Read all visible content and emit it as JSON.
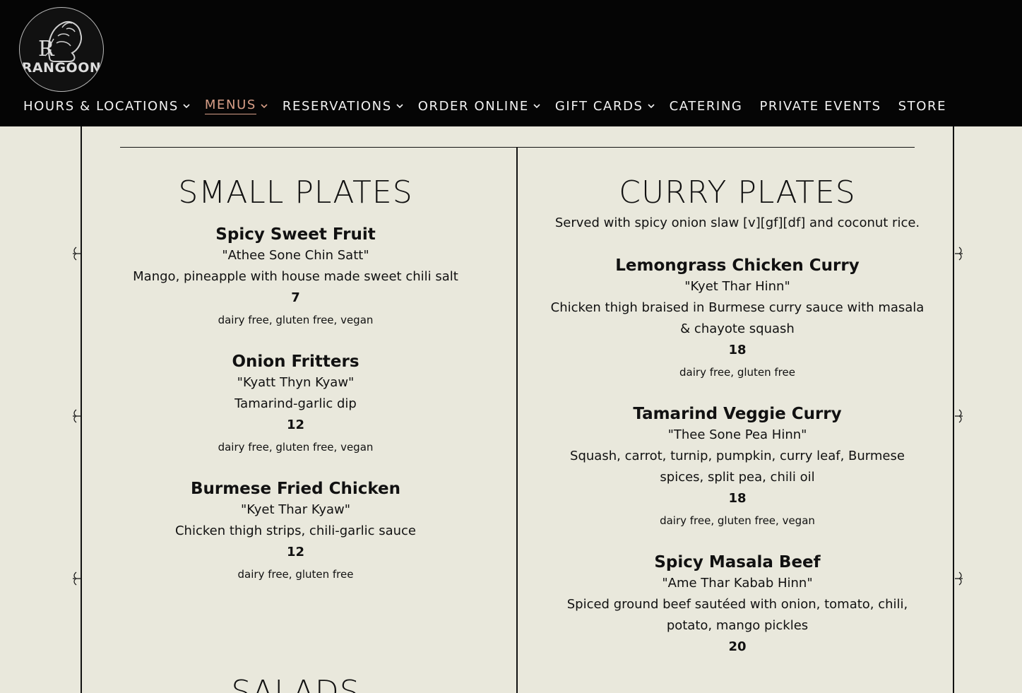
{
  "brand": {
    "logo_text": "RANGOON"
  },
  "nav": [
    {
      "label": "HOURS & LOCATIONS",
      "has_dropdown": true,
      "active": false
    },
    {
      "label": "MENUS",
      "has_dropdown": true,
      "active": true
    },
    {
      "label": "RESERVATIONS",
      "has_dropdown": true,
      "active": false
    },
    {
      "label": "ORDER ONLINE",
      "has_dropdown": true,
      "active": false
    },
    {
      "label": "GIFT CARDS",
      "has_dropdown": true,
      "active": false
    },
    {
      "label": "CATERING",
      "has_dropdown": false,
      "active": false
    },
    {
      "label": "PRIVATE EVENTS",
      "has_dropdown": false,
      "active": false
    },
    {
      "label": "STORE",
      "has_dropdown": false,
      "active": false
    }
  ],
  "colors": {
    "header_bg": "#050505",
    "page_bg": "#e9e8dc",
    "active_nav": "#d79e87"
  },
  "small_plates": {
    "title": "SMALL PLATES",
    "items": [
      {
        "name": "Spicy Sweet Fruit",
        "alt": "\"Athee Sone Chin Satt\"",
        "desc": "Mango, pineapple with house made sweet chili salt",
        "price": "7",
        "diet": "dairy free, gluten free, vegan"
      },
      {
        "name": "Onion Fritters",
        "alt": "\"Kyatt Thyn Kyaw\"",
        "desc": "Tamarind-garlic dip",
        "price": "12",
        "diet": "dairy free, gluten free, vegan"
      },
      {
        "name": "Burmese Fried Chicken",
        "alt": "\"Kyet Thar Kyaw\"",
        "desc": "Chicken thigh strips, chili-garlic sauce",
        "price": "12",
        "diet": "dairy free, gluten free"
      }
    ]
  },
  "curry_plates": {
    "title": "CURRY PLATES",
    "note": "Served with spicy onion slaw [v][gf][df] and coconut rice.",
    "items": [
      {
        "name": "Lemongrass Chicken Curry",
        "alt": "\"Kyet Thar Hinn\"",
        "desc": "Chicken thigh braised in Burmese curry sauce with masala & chayote squash",
        "price": "18",
        "diet": "dairy free, gluten free"
      },
      {
        "name": "Tamarind Veggie Curry",
        "alt": "\"Thee Sone Pea Hinn\"",
        "desc": "Squash, carrot, turnip, pumpkin, curry leaf, Burmese spices, split pea, chili oil",
        "price": "18",
        "diet": "dairy free, gluten free, vegan"
      },
      {
        "name": "Spicy Masala Beef",
        "alt": "\"Ame Thar Kabab Hinn\"",
        "desc": "Spiced ground beef sautéed with onion, tomato, chili, potato, mango pickles",
        "price": "20",
        "diet": ""
      }
    ]
  },
  "salads": {
    "title": "SALADS"
  }
}
